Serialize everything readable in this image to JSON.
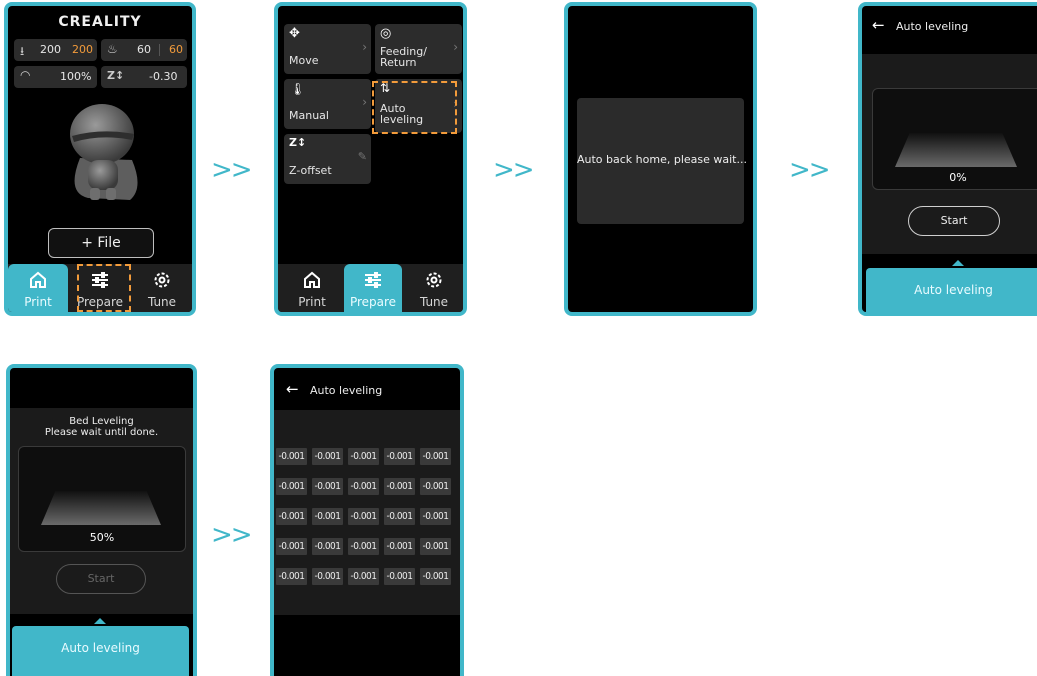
{
  "screen1": {
    "logo": "CREALITY",
    "nozzle_current": "200",
    "nozzle_target": "200",
    "bed_current": "60",
    "bed_target": "60",
    "speed": "100%",
    "zoffset_icon_text": "Z↕",
    "zoffset": "-0.30",
    "file_button": "+ File",
    "nav": [
      "Print",
      "Prepare",
      "Tune"
    ]
  },
  "screen2": {
    "tiles": [
      {
        "label": "Move"
      },
      {
        "label": "Feeding/\nReturn"
      },
      {
        "label": "Manual"
      },
      {
        "label": "Auto\nleveling"
      },
      {
        "label": "Z-offset"
      }
    ],
    "zicon": "Z↕",
    "nav": [
      "Print",
      "Prepare",
      "Tune"
    ]
  },
  "screen3": {
    "message": "Auto back home, please wait..."
  },
  "screen4": {
    "title": "Auto leveling",
    "progress": "0%",
    "start": "Start",
    "tab": "Auto leveling"
  },
  "screen5": {
    "status_line1": "Bed Leveling",
    "status_line2": "Please wait until done.",
    "progress": "50%",
    "start": "Start",
    "tab": "Auto leveling"
  },
  "screen6": {
    "title": "Auto leveling",
    "grid": [
      [
        "-0.001",
        "-0.001",
        "-0.001",
        "-0.001",
        "-0.001"
      ],
      [
        "-0.001",
        "-0.001",
        "-0.001",
        "-0.001",
        "-0.001"
      ],
      [
        "-0.001",
        "-0.001",
        "-0.001",
        "-0.001",
        "-0.001"
      ],
      [
        "-0.001",
        "-0.001",
        "-0.001",
        "-0.001",
        "-0.001"
      ],
      [
        "-0.001",
        "-0.001",
        "-0.001",
        "-0.001",
        "-0.001"
      ]
    ]
  },
  "arrow": ">>",
  "colors": {
    "accent": "#41b7c9",
    "highlight": "#f29b3b",
    "tile": "#2c2c2c"
  }
}
